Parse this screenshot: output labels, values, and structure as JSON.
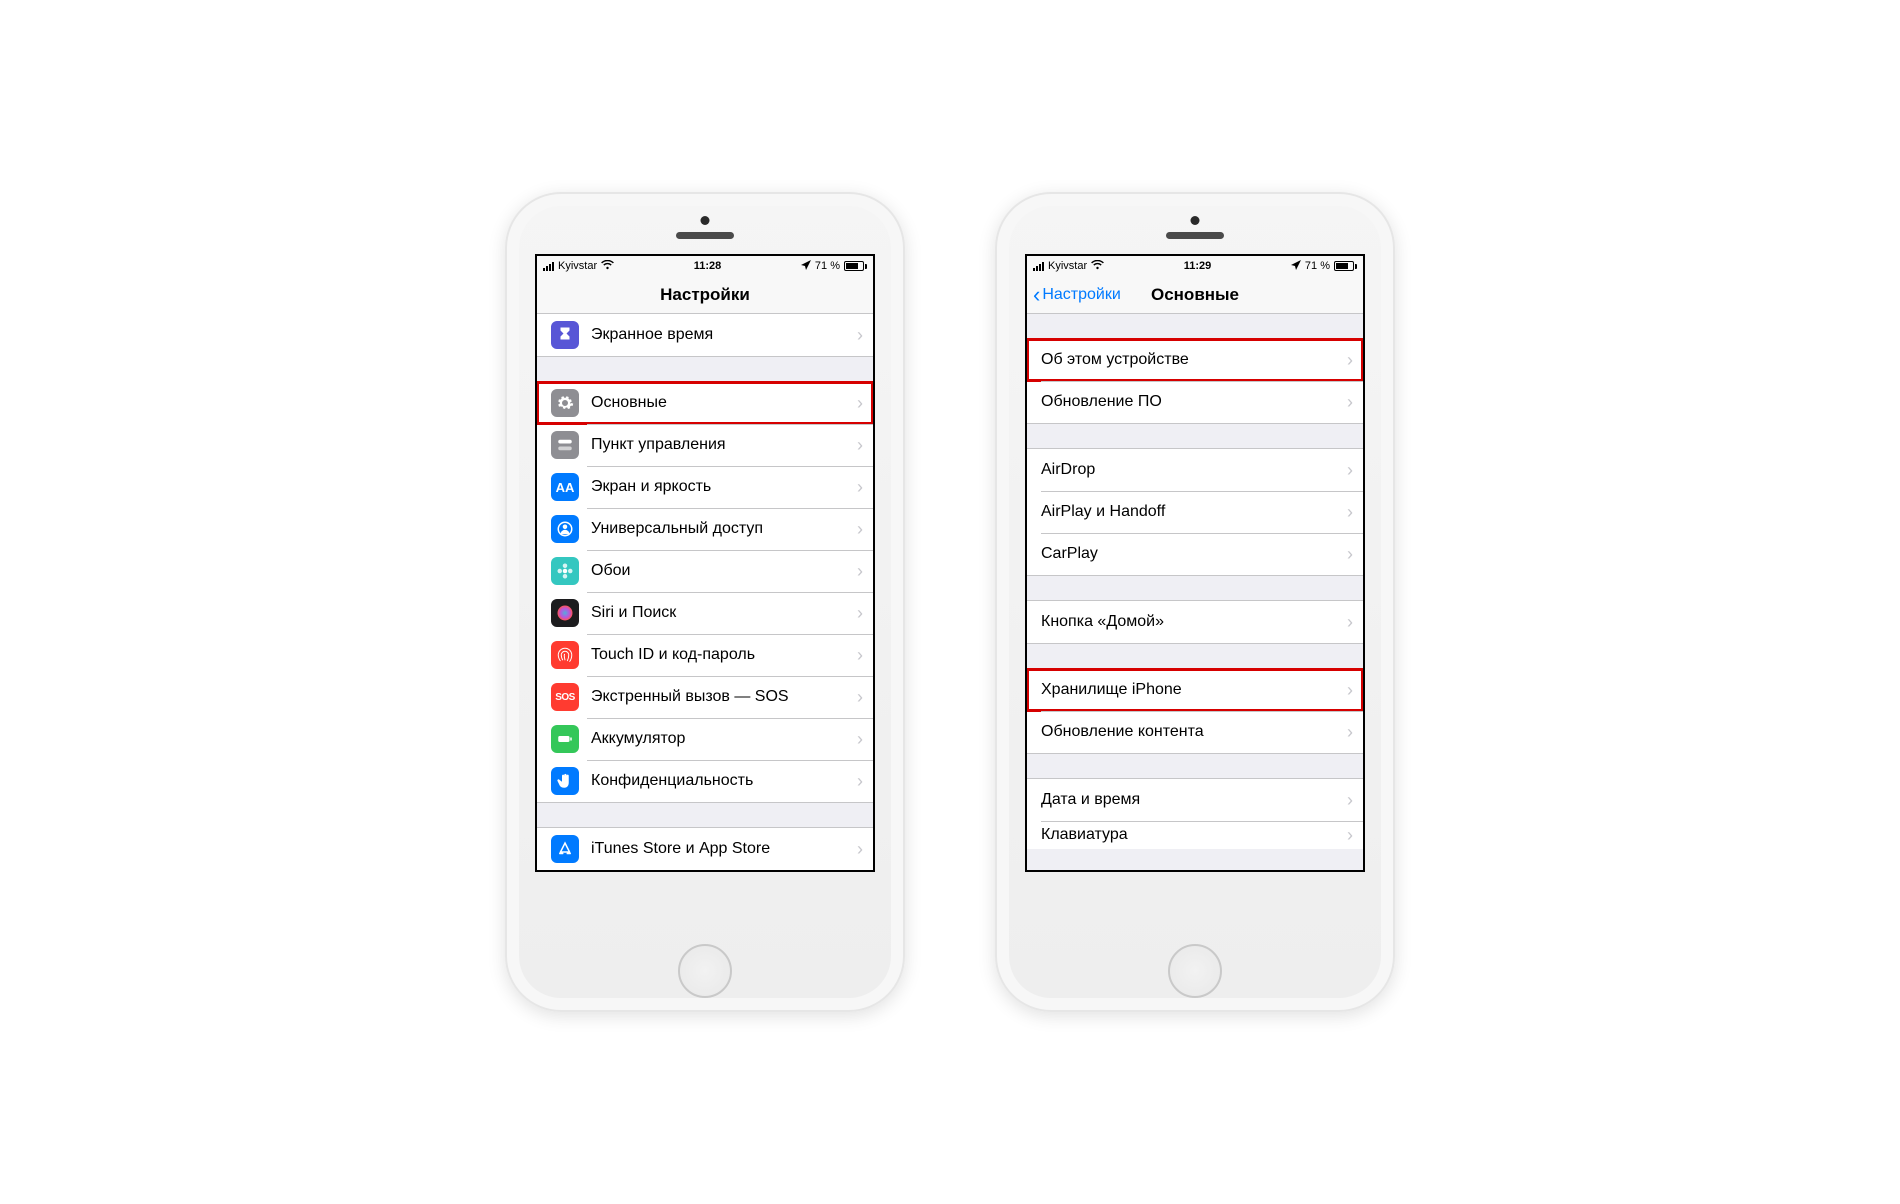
{
  "phones": [
    {
      "status": {
        "carrier": "Kyivstar",
        "time": "11:28",
        "battery": "71 %"
      },
      "nav": {
        "title": "Настройки",
        "back": null
      },
      "groups": [
        {
          "partialTop": true,
          "icons": true,
          "items": [
            {
              "label": "Экранное время",
              "icon": "hourglass",
              "color": "#5856d6"
            }
          ]
        },
        {
          "icons": true,
          "items": [
            {
              "label": "Основные",
              "icon": "gear",
              "color": "#8e8e93",
              "highlight": true
            },
            {
              "label": "Пункт управления",
              "icon": "switches",
              "color": "#8e8e93"
            },
            {
              "label": "Экран и яркость",
              "icon": "AA",
              "color": "#007aff"
            },
            {
              "label": "Универсальный доступ",
              "icon": "person",
              "color": "#007aff"
            },
            {
              "label": "Обои",
              "icon": "flower",
              "color": "#34c7c0"
            },
            {
              "label": "Siri и Поиск",
              "icon": "siri",
              "color": "#1c1c1e"
            },
            {
              "label": "Touch ID и код-пароль",
              "icon": "fingerprint",
              "color": "#ff3b30"
            },
            {
              "label": "Экстренный вызов — SOS",
              "icon": "SOS",
              "color": "#ff3b30"
            },
            {
              "label": "Аккумулятор",
              "icon": "battery",
              "color": "#34c759"
            },
            {
              "label": "Конфиденциальность",
              "icon": "hand",
              "color": "#007aff"
            }
          ]
        },
        {
          "icons": true,
          "partialBottom": true,
          "items": [
            {
              "label": "iTunes Store и App Store",
              "icon": "appstore",
              "color": "#007aff"
            }
          ]
        }
      ]
    },
    {
      "status": {
        "carrier": "Kyivstar",
        "time": "11:29",
        "battery": "71 %"
      },
      "nav": {
        "title": "Основные",
        "back": "Настройки"
      },
      "groups": [
        {
          "icons": false,
          "items": [
            {
              "label": "Об этом устройстве",
              "highlight": true
            },
            {
              "label": "Обновление ПО"
            }
          ]
        },
        {
          "icons": false,
          "items": [
            {
              "label": "AirDrop"
            },
            {
              "label": "AirPlay и Handoff"
            },
            {
              "label": "CarPlay"
            }
          ]
        },
        {
          "icons": false,
          "items": [
            {
              "label": "Кнопка «Домой»"
            }
          ]
        },
        {
          "icons": false,
          "items": [
            {
              "label": "Хранилище iPhone",
              "highlight": true
            },
            {
              "label": "Обновление контента"
            }
          ]
        },
        {
          "icons": false,
          "partialBottom": true,
          "items": [
            {
              "label": "Дата и время"
            },
            {
              "label": "Клавиатура",
              "cut": true
            }
          ]
        }
      ]
    }
  ]
}
